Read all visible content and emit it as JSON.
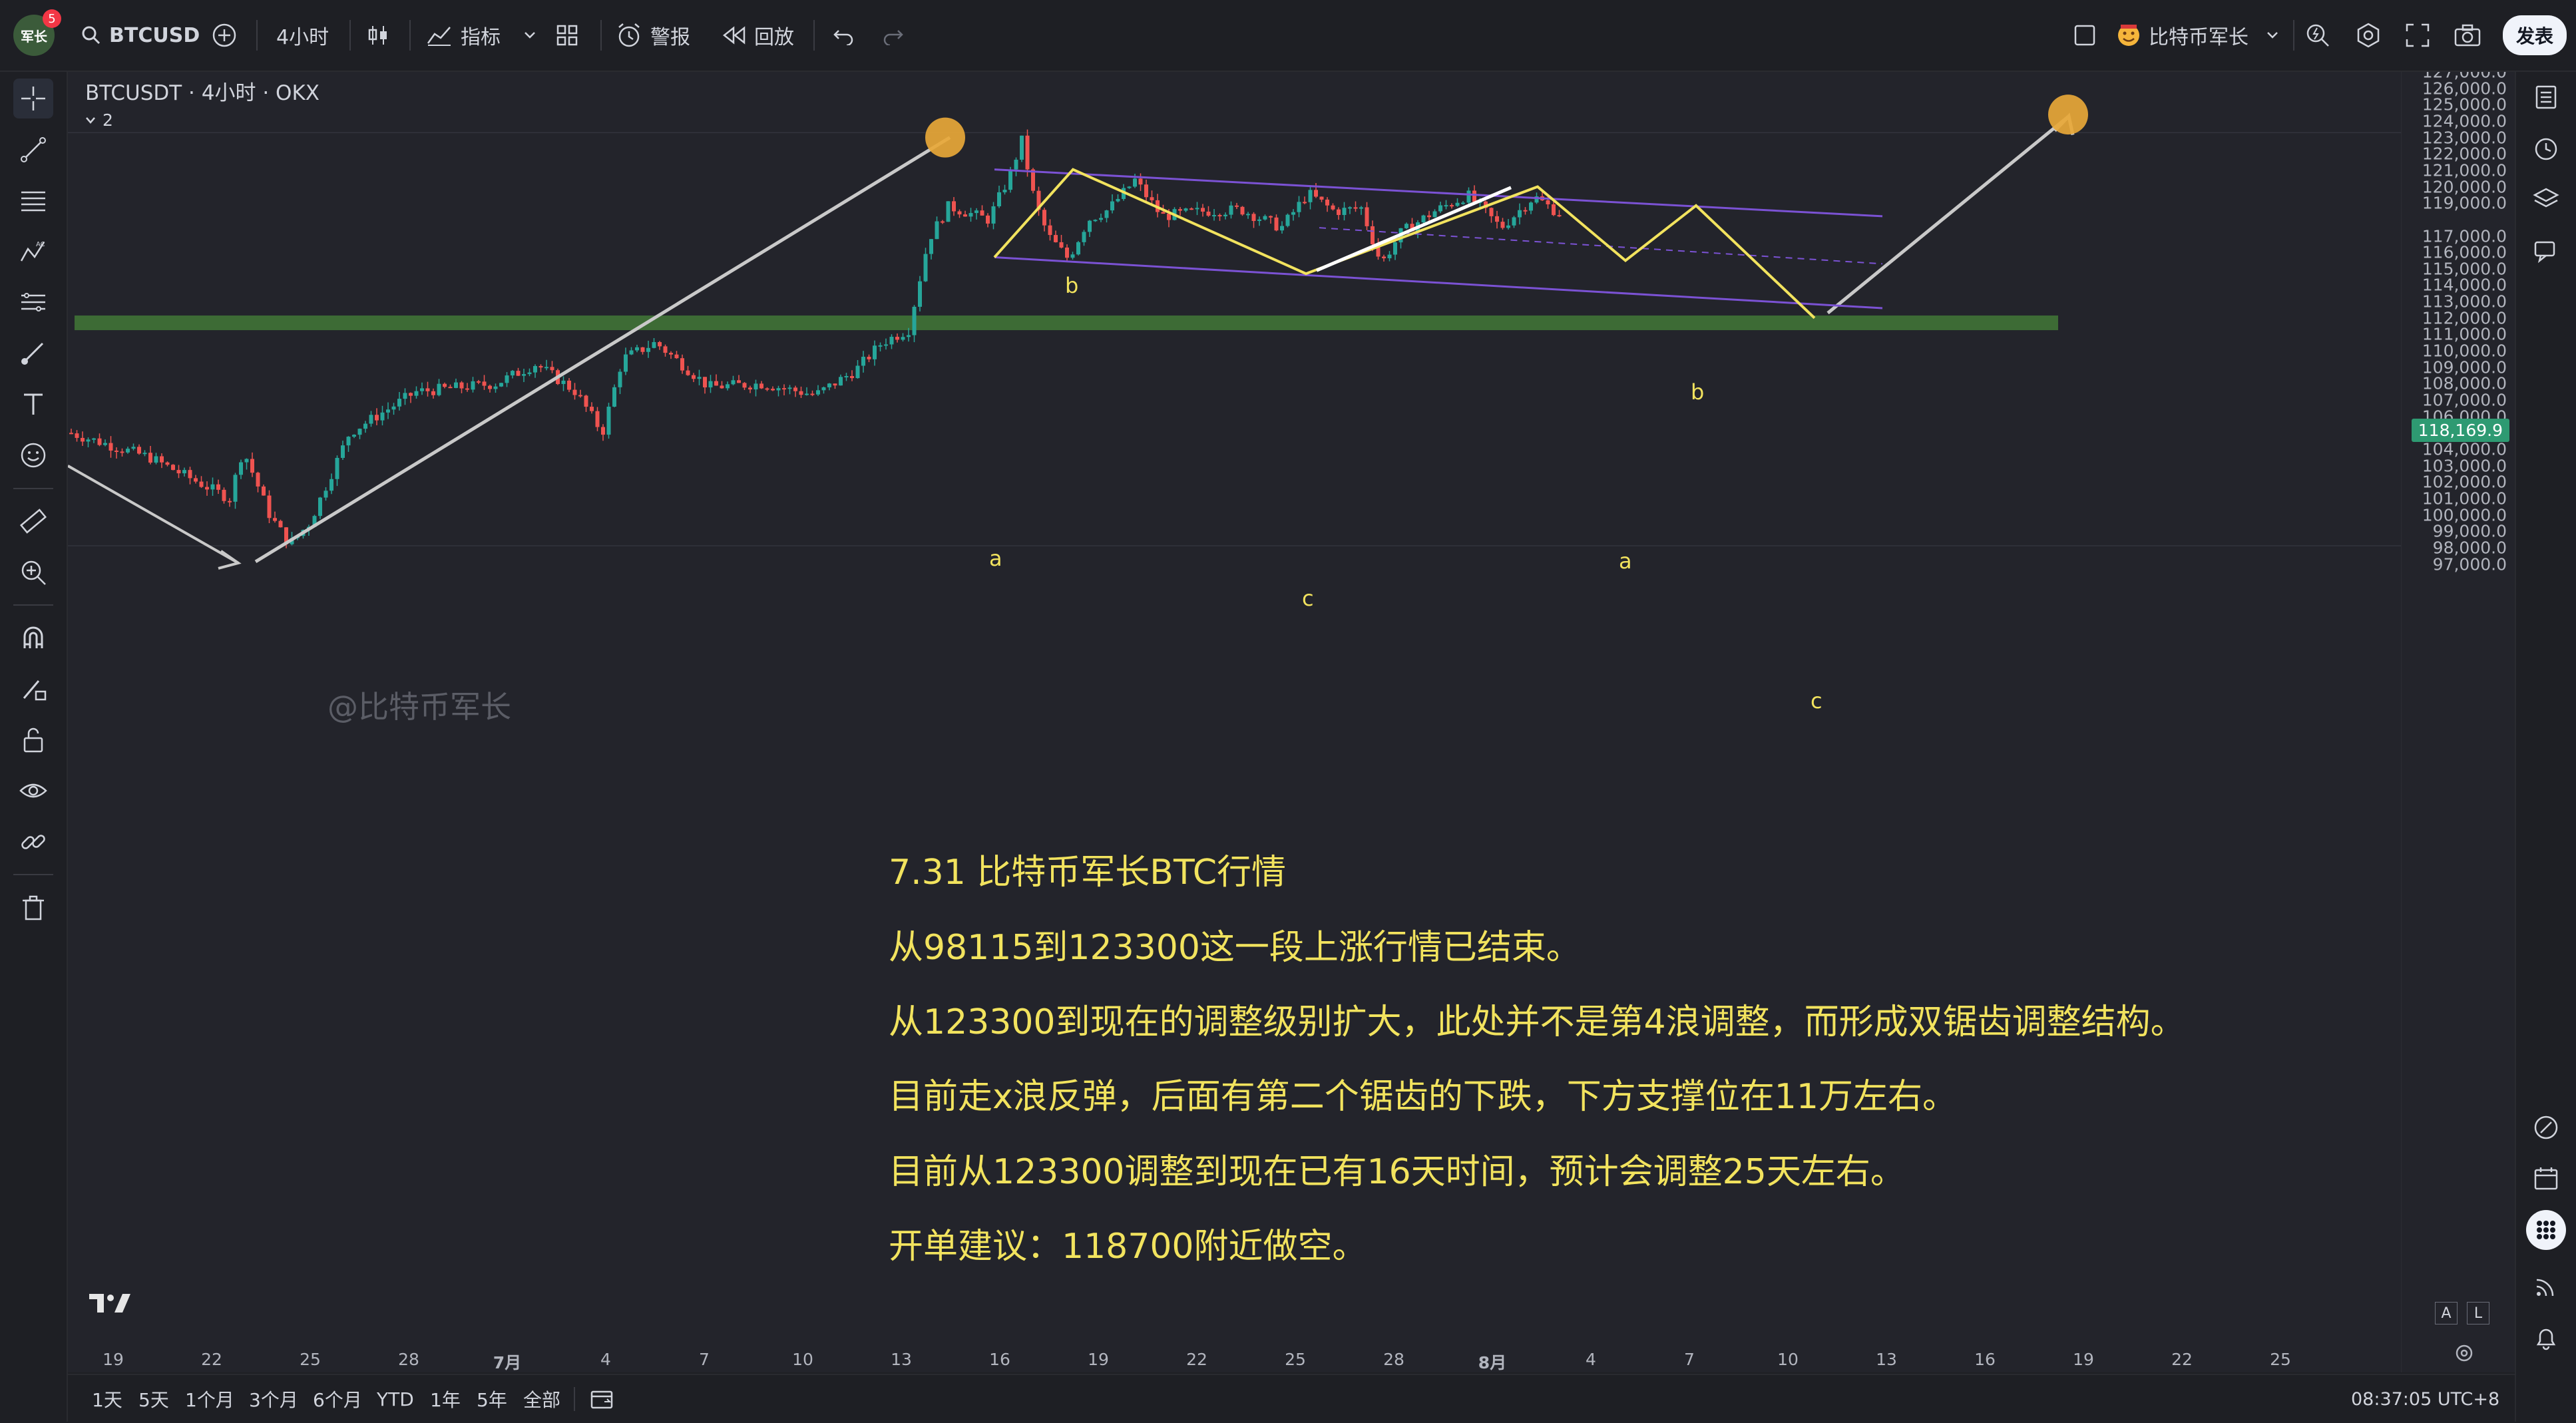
{
  "topbar": {
    "avatar_label": "军长",
    "notif_count": "5",
    "symbol": "BTCUSD",
    "interval": "4小时",
    "indicators_label": "指标",
    "alert_label": "警报",
    "replay_label": "回放",
    "account_name": "比特币军长",
    "publish_label": "发表"
  },
  "chart": {
    "header_title": "BTCUSDT · 4小时 · OKX",
    "collapse_count": "2",
    "watermark": "@比特币军长",
    "current_price": "118,169.9",
    "wave_labels": [
      "a",
      "b",
      "c",
      "a",
      "b",
      "c"
    ],
    "price_ticks": [
      "127,000.0",
      "126,000.0",
      "125,000.0",
      "124,000.0",
      "123,000.0",
      "122,000.0",
      "121,000.0",
      "120,000.0",
      "119,000.0",
      "117,000.0",
      "116,000.0",
      "115,000.0",
      "114,000.0",
      "113,000.0",
      "112,000.0",
      "111,000.0",
      "110,000.0",
      "109,000.0",
      "108,000.0",
      "107,000.0",
      "106,000.0",
      "105,000.0",
      "104,000.0",
      "103,000.0",
      "102,000.0",
      "101,000.0",
      "100,000.0",
      "99,000.0",
      "98,000.0",
      "97,000.0"
    ],
    "time_ticks": [
      "19",
      "22",
      "25",
      "28",
      "7月",
      "4",
      "7",
      "10",
      "13",
      "16",
      "19",
      "22",
      "25",
      "28",
      "8月",
      "4",
      "7",
      "10",
      "13",
      "16",
      "19",
      "22",
      "25"
    ],
    "scale_modes": [
      "A",
      "L"
    ],
    "accent_colors": {
      "up": "#26a69a",
      "down": "#ef5350",
      "wave": "#f2e35e",
      "channel": "#7b52d4",
      "support": "#3d6b35",
      "target": "#e8a838"
    },
    "support_price": 112000,
    "target_price": 124000,
    "top_price": 123300,
    "low_price": 98115
  },
  "analysis": {
    "title": "7.31 比特币军长BTC行情",
    "lines": [
      "从98115到123300这一段上涨行情已结束。",
      "从123300到现在的调整级别扩大，此处并不是第4浪调整，而形成双锯齿调整结构。",
      "目前走x浪反弹，后面有第二个锯齿的下跌，下方支撑位在11万左右。",
      "目前从123300调整到现在已有16天时间，预计会调整25天左右。",
      "开单建议：118700附近做空。"
    ]
  },
  "bottombar": {
    "ranges": [
      "1天",
      "5天",
      "1个月",
      "3个月",
      "6个月",
      "YTD",
      "1年",
      "5年",
      "全部"
    ],
    "clock": "08:37:05 UTC+8"
  }
}
